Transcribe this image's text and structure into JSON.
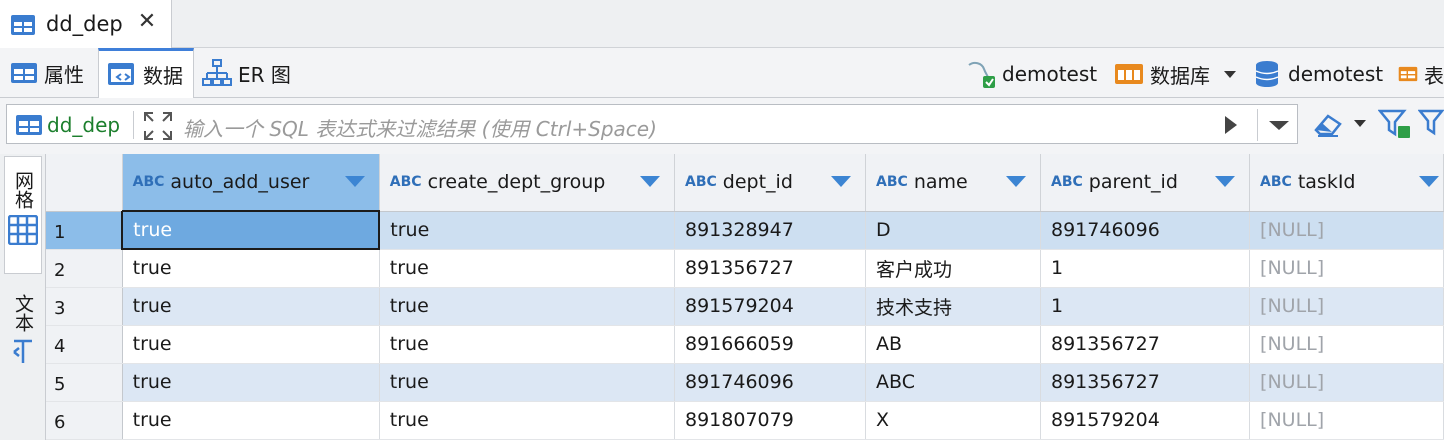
{
  "editor_tab": {
    "title": "dd_dep"
  },
  "view_tabs": [
    {
      "label": "属性",
      "icon": "properties-icon"
    },
    {
      "label": "数据",
      "icon": "data-grid-icon",
      "active": true
    },
    {
      "label": "ER 图",
      "icon": "er-diagram-icon"
    }
  ],
  "toolbar_right": {
    "connection": "demotest",
    "database_type": "数据库",
    "database": "demotest",
    "table_partial": "表"
  },
  "filter": {
    "table_name": "dd_dep",
    "placeholder": "输入一个 SQL 表达式来过滤结果 (使用 Ctrl+Space)"
  },
  "side_tabs": [
    {
      "label": "网格",
      "icon": "grid-icon",
      "active": true
    },
    {
      "label": "文本",
      "icon": "text-icon"
    }
  ],
  "grid": {
    "columns": [
      {
        "name": "auto_add_user",
        "type_label": "ABC",
        "type_icon": "string-type-icon"
      },
      {
        "name": "create_dept_group",
        "type_label": "ABC",
        "type_icon": "string-type-icon"
      },
      {
        "name": "dept_id",
        "type_label": "ABC",
        "type_icon": "key-string-type-icon"
      },
      {
        "name": "name",
        "type_label": "ABC",
        "type_icon": "string-type-icon"
      },
      {
        "name": "parent_id",
        "type_label": "ABC",
        "type_icon": "string-type-icon"
      },
      {
        "name": "taskId",
        "type_label": "ABC",
        "type_icon": "string-type-icon"
      }
    ],
    "rows": [
      {
        "n": "1",
        "cells": [
          "true",
          "true",
          "891328947",
          "D",
          "891746096",
          "[NULL]"
        ]
      },
      {
        "n": "2",
        "cells": [
          "true",
          "true",
          "891356727",
          "客户成功",
          "1",
          "[NULL]"
        ]
      },
      {
        "n": "3",
        "cells": [
          "true",
          "true",
          "891579204",
          "技术支持",
          "1",
          "[NULL]"
        ]
      },
      {
        "n": "4",
        "cells": [
          "true",
          "true",
          "891666059",
          "AB",
          "891356727",
          "[NULL]"
        ]
      },
      {
        "n": "5",
        "cells": [
          "true",
          "true",
          "891746096",
          "ABC",
          "891356727",
          "[NULL]"
        ]
      },
      {
        "n": "6",
        "cells": [
          "true",
          "true",
          "891807079",
          "X",
          "891579204",
          "[NULL]"
        ]
      }
    ]
  },
  "colors": {
    "accent": "#3c85d3",
    "selected_header": "#8cbde9",
    "alt_row": "#dce7f4",
    "null_text": "#a0a4aa"
  }
}
